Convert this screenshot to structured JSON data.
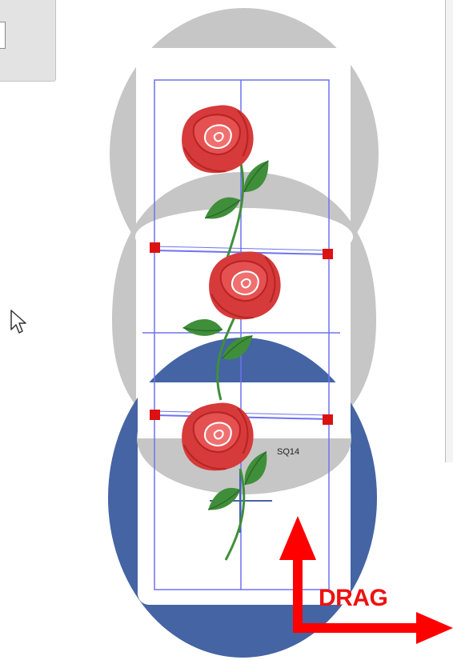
{
  "toolbar": {
    "panel_icon": "toolbar-panel"
  },
  "cursor": {
    "icon": "mouse-pointer-icon"
  },
  "hoops": [
    {
      "name": "hoop-top",
      "color": "#c6c6c6",
      "state": "inactive"
    },
    {
      "name": "hoop-middle",
      "color": "#c6c6c6",
      "state": "inactive"
    },
    {
      "name": "hoop-bottom",
      "color": "#4464a4",
      "state": "active"
    }
  ],
  "hoop_label": "SQ14",
  "drag_label": "DRAG",
  "colors": {
    "active_hoop": "#4464a4",
    "inactive_hoop": "#c6c6c6",
    "guide_lines": "#6f72f0",
    "handles": "#dd1111",
    "arrow": "#ff0000",
    "rose": "#d63a3a",
    "leaf": "#3f8f3a"
  },
  "icons": [
    "rose-flower-icon",
    "leaf-icon",
    "drag-arrow-icon",
    "mouse-pointer-icon"
  ]
}
